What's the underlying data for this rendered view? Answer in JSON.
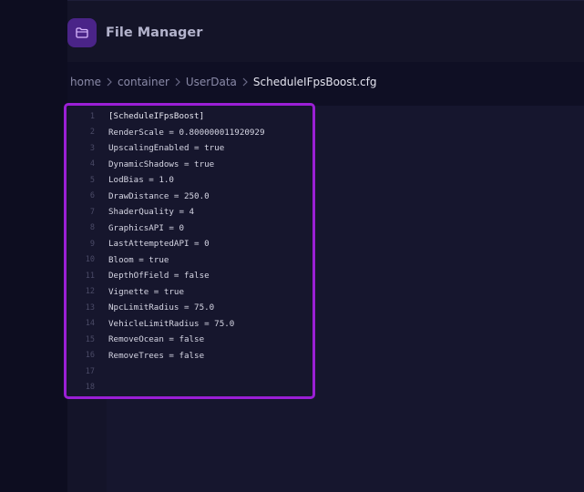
{
  "app": {
    "title": "File Manager",
    "icon": "folder-icon",
    "accent": "#9b1fd6"
  },
  "breadcrumb": {
    "items": [
      "home",
      "container",
      "UserData",
      "ScheduleIFpsBoost.cfg"
    ],
    "separator_icon": "chevron-right-icon"
  },
  "editor": {
    "lines": [
      {
        "n": "1",
        "text": "[ScheduleIFpsBoost]"
      },
      {
        "n": "2",
        "text": "RenderScale = 0.800000011920929"
      },
      {
        "n": "3",
        "text": "UpscalingEnabled = true"
      },
      {
        "n": "4",
        "text": "DynamicShadows = true"
      },
      {
        "n": "5",
        "text": "LodBias = 1.0"
      },
      {
        "n": "6",
        "text": "DrawDistance = 250.0"
      },
      {
        "n": "7",
        "text": "ShaderQuality = 4"
      },
      {
        "n": "8",
        "text": "GraphicsAPI = 0"
      },
      {
        "n": "9",
        "text": "LastAttemptedAPI = 0"
      },
      {
        "n": "10",
        "text": "Bloom = true"
      },
      {
        "n": "11",
        "text": "DepthOfField = false"
      },
      {
        "n": "12",
        "text": "Vignette = true"
      },
      {
        "n": "13",
        "text": "NpcLimitRadius = 75.0"
      },
      {
        "n": "14",
        "text": "VehicleLimitRadius = 75.0"
      },
      {
        "n": "15",
        "text": "RemoveOcean = false"
      },
      {
        "n": "16",
        "text": "RemoveTrees = false"
      },
      {
        "n": "17",
        "text": ""
      },
      {
        "n": "18",
        "text": ""
      }
    ]
  }
}
